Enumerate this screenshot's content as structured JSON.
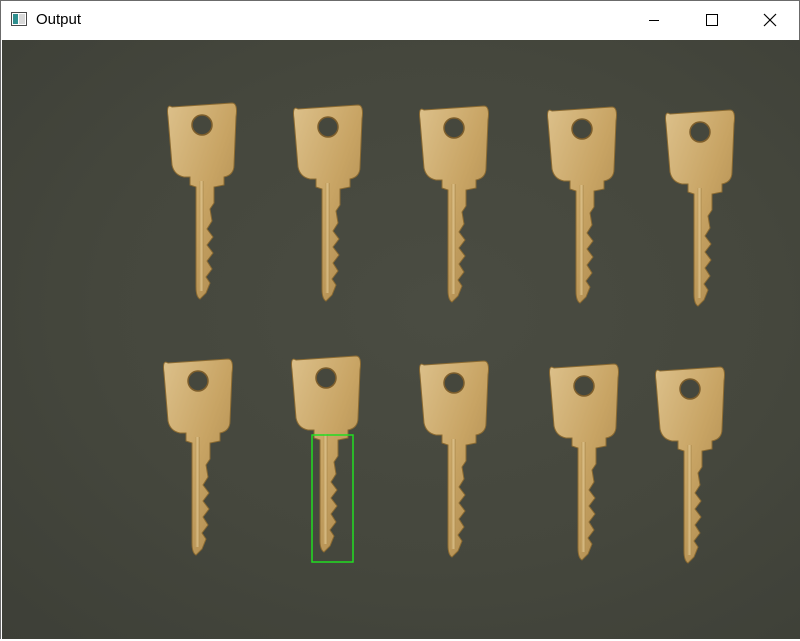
{
  "window": {
    "title": "Output",
    "app_icon": "opencv-window-icon",
    "controls": {
      "minimize_icon": "minimize-icon",
      "maximize_icon": "maximize-icon",
      "close_icon": "close-icon"
    }
  },
  "image": {
    "description_icon": "keys-photo",
    "background_color": "#45473d",
    "key_color": "#c9a86a",
    "key_count": 10,
    "detection_box_color": "#22dd22"
  }
}
